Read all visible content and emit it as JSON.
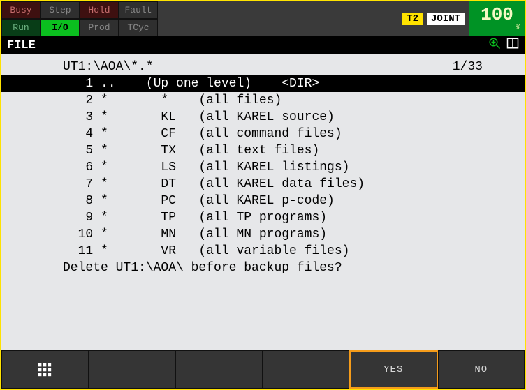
{
  "status": {
    "row1": {
      "busy": "Busy",
      "step": "Step",
      "hold": "Hold",
      "fault": "Fault"
    },
    "row2": {
      "run": "Run",
      "io": "I/O",
      "prod": "Prod",
      "tcyc": "TCyc"
    },
    "mode": "T2",
    "coord": "JOINT",
    "speed_value": "100",
    "speed_unit": "%"
  },
  "title": "FILE",
  "listing": {
    "path": "UT1:\\AOA\\*.*",
    "counter": "1/33",
    "rows": [
      {
        "num": "1",
        "name": "..",
        "ext": "(Up one level)",
        "desc": "<DIR>",
        "selected": true
      },
      {
        "num": "2",
        "name": "*",
        "ext": "*",
        "desc": "(all files)"
      },
      {
        "num": "3",
        "name": "*",
        "ext": "KL",
        "desc": "(all KAREL source)"
      },
      {
        "num": "4",
        "name": "*",
        "ext": "CF",
        "desc": "(all command files)"
      },
      {
        "num": "5",
        "name": "*",
        "ext": "TX",
        "desc": "(all text files)"
      },
      {
        "num": "6",
        "name": "*",
        "ext": "LS",
        "desc": "(all KAREL listings)"
      },
      {
        "num": "7",
        "name": "*",
        "ext": "DT",
        "desc": "(all KAREL data files)"
      },
      {
        "num": "8",
        "name": "*",
        "ext": "PC",
        "desc": "(all KAREL p-code)"
      },
      {
        "num": "9",
        "name": "*",
        "ext": "TP",
        "desc": "(all TP programs)"
      },
      {
        "num": "10",
        "name": "*",
        "ext": "MN",
        "desc": "(all MN programs)"
      },
      {
        "num": "11",
        "name": "*",
        "ext": "VR",
        "desc": "(all variable files)"
      }
    ],
    "prompt": "Delete UT1:\\AOA\\ before backup files?"
  },
  "softkeys": {
    "f1": "",
    "f2": "",
    "f3": "",
    "f4": "YES",
    "f5": "NO",
    "active": "f4"
  }
}
